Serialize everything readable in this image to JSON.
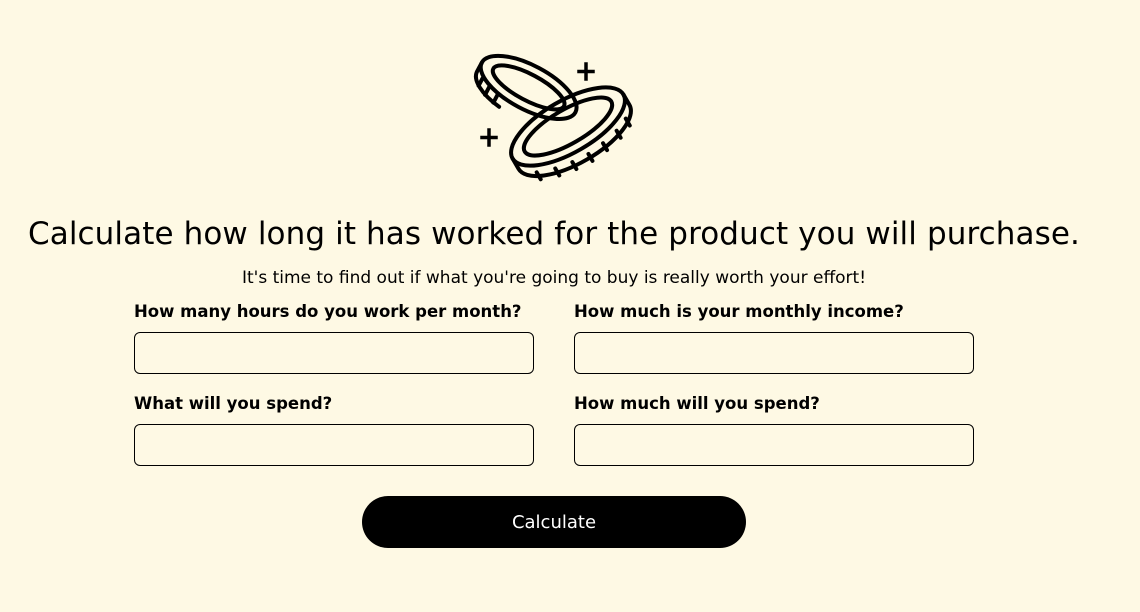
{
  "header": {
    "logo_icon": "coins-icon",
    "title": "Calculate how long it has worked for the product you will purchase.",
    "subtitle": "It's time to find out if what you're going to buy is really worth your effort!"
  },
  "form": {
    "hours": {
      "label": "How many hours do you work per month?",
      "value": "",
      "placeholder": ""
    },
    "income": {
      "label": "How much is your monthly income?",
      "value": "",
      "placeholder": ""
    },
    "item": {
      "label": "What will you spend?",
      "value": "",
      "placeholder": ""
    },
    "amount": {
      "label": "How much will you spend?",
      "value": "",
      "placeholder": ""
    },
    "submit_label": "Calculate"
  },
  "colors": {
    "background": "#fef9e4",
    "button": "#000000",
    "button_text": "#ffffff"
  }
}
